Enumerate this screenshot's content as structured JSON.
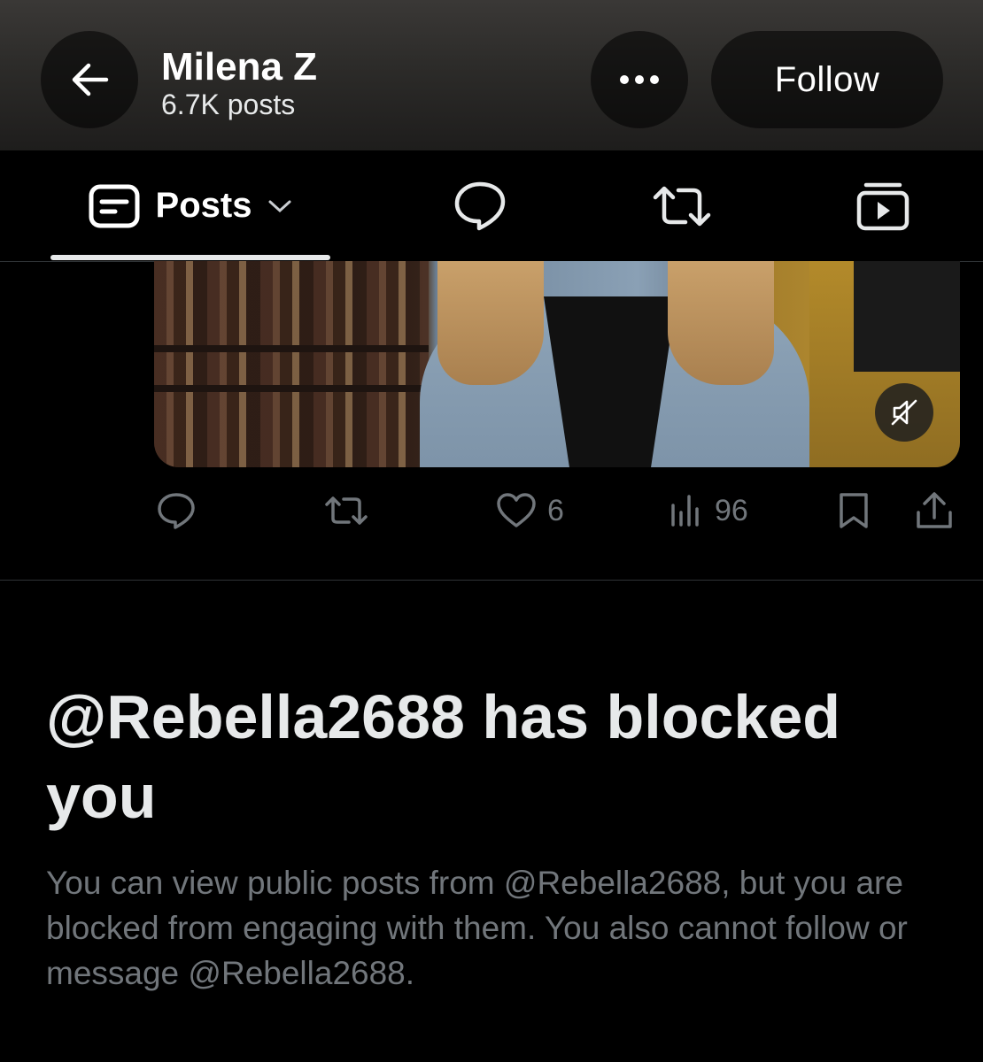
{
  "header": {
    "name": "Milena Z",
    "posts_count": "6.7K posts",
    "follow_label": "Follow",
    "back_icon": "arrow-left-icon",
    "more_icon": "more-dots-icon"
  },
  "tabs": {
    "posts_label": "Posts",
    "items": [
      "posts",
      "replies",
      "reposts",
      "media"
    ]
  },
  "post": {
    "likes": "6",
    "views": "96"
  },
  "blocked": {
    "title": "@Rebella2688 has blocked you",
    "description": "You can view public posts from @Rebella2688, but you are blocked from engaging with them. You also cannot follow or message @Rebella2688."
  },
  "colors": {
    "background": "#000000",
    "text": "#e7e9ea",
    "muted": "#71767b",
    "divider": "#2f3336"
  }
}
